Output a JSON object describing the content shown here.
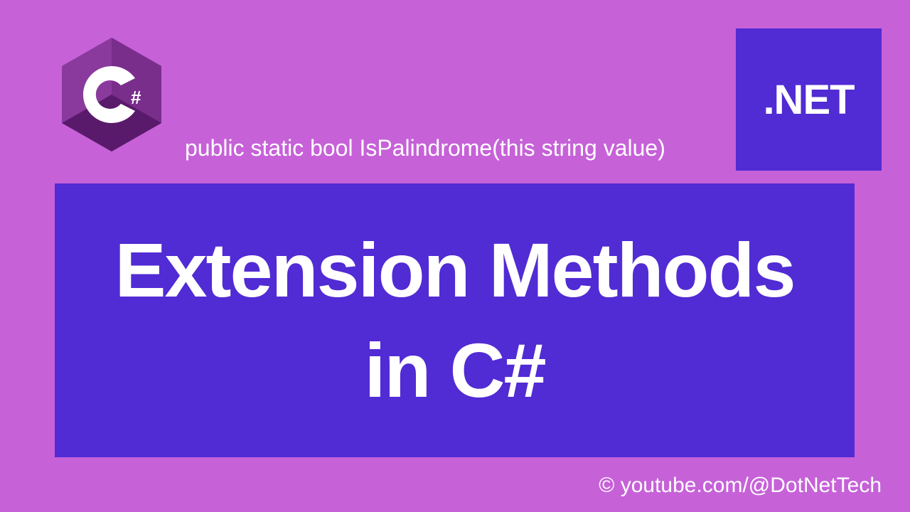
{
  "dotnet_label": ".NET",
  "code_snippet": "public static bool IsPalindrome(this string value)",
  "title_line1": "Extension Methods",
  "title_line2": "in C#",
  "credit": "© youtube.com/@DotNetTech",
  "colors": {
    "background": "#c661d8",
    "accent": "#512bd4",
    "text": "#ffffff"
  }
}
